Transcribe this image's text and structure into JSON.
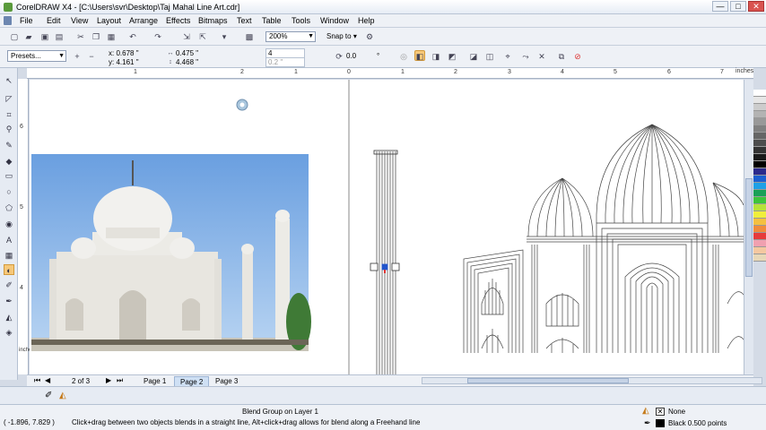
{
  "window": {
    "title": "CorelDRAW X4 - [C:\\Users\\svr\\Desktop\\Taj Mahal Line Art.cdr]",
    "controls": [
      "—",
      "□",
      "✕"
    ]
  },
  "menu": [
    "File",
    "Edit",
    "View",
    "Layout",
    "Arrange",
    "Effects",
    "Bitmaps",
    "Text",
    "Table",
    "Tools",
    "Window",
    "Help"
  ],
  "toolbar": {
    "zoom": "200%",
    "snap_to": "Snap to"
  },
  "property_bar": {
    "presets": "Presets...",
    "x": "x: 0.678 \"",
    "y": "y: 4.161 \"",
    "width": "0.475 \"",
    "height": "4.468 \"",
    "steps": "4",
    "spacing": "0.2 \"",
    "rotation": "0.0",
    "degree_symbol": "°"
  },
  "rulers": {
    "units": "inches",
    "h_labels": [
      "1",
      "2",
      "1",
      "0",
      "1",
      "2",
      "3",
      "4",
      "5",
      "6",
      "7"
    ],
    "v_labels": [
      "6",
      "5",
      "4"
    ],
    "v_unit": "inches"
  },
  "page_tabs": {
    "page_info": "2 of 3",
    "tabs": [
      "Page 1",
      "Page 2",
      "Page 3"
    ],
    "active_index": 1
  },
  "status": {
    "coords": "( -1.896, 7.829 )",
    "object_info": "Blend Group on Layer 1",
    "hint": "Click+drag between two objects blends in a straight line, Alt+click+drag allows for blend along a Freehand line",
    "fill": "None",
    "outline": "Black  0.500 points"
  },
  "colors": {
    "accent": "#f6c87a",
    "palette": [
      "#ffffff",
      "#e6e6e6",
      "#cccccc",
      "#b3b3b3",
      "#999999",
      "#808080",
      "#666666",
      "#4d4d4d",
      "#333333",
      "#1a1a1a",
      "#000000",
      "#2c2a8c",
      "#1c5fd0",
      "#1ea0e6",
      "#1aa058",
      "#3cc43c",
      "#b6e23a",
      "#f0ee3c",
      "#f4c040",
      "#f08c3c",
      "#e63c3c",
      "#f0a0b0",
      "#f4c8a0",
      "#e8d8b8"
    ]
  }
}
